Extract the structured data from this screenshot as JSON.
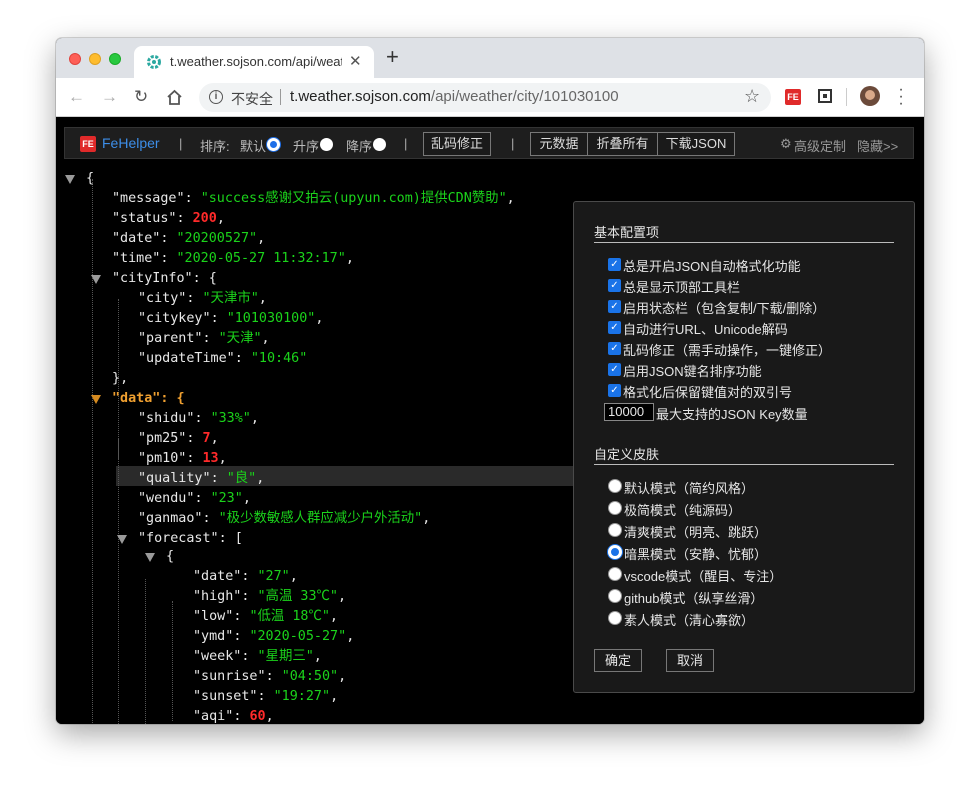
{
  "browser": {
    "tab_title": "t.weather.sojson.com/api/weat",
    "insecure_label": "不安全",
    "url_host": "t.weather.sojson.com",
    "url_path": "/api/weather/city/101030100"
  },
  "fehelper": {
    "brand": "FeHelper",
    "sort_label": "排序:",
    "sort_default": "默认",
    "sort_asc": "升序",
    "sort_desc": "降序",
    "fix_button": "乱码修正",
    "raw_button": "元数据",
    "collapse_button": "折叠所有",
    "download_button": "下载JSON",
    "advanced": "高级定制",
    "hide": "隐藏>>"
  },
  "json_view": {
    "lines": [
      {
        "indent": 0,
        "key": "",
        "sep": "",
        "value": "{",
        "vtype": "p",
        "comma": ""
      },
      {
        "indent": 1,
        "key": "\"message\"",
        "sep": ": ",
        "value": "\"success感谢又拍云(upyun.com)提供CDN赞助\"",
        "vtype": "s",
        "comma": ","
      },
      {
        "indent": 1,
        "key": "\"status\"",
        "sep": ": ",
        "value": "200",
        "vtype": "n",
        "comma": ","
      },
      {
        "indent": 1,
        "key": "\"date\"",
        "sep": ": ",
        "value": "\"20200527\"",
        "vtype": "s",
        "comma": ","
      },
      {
        "indent": 1,
        "key": "\"time\"",
        "sep": ": ",
        "value": "\"2020-05-27 11:32:17\"",
        "vtype": "s",
        "comma": ","
      },
      {
        "indent": 1,
        "key": "\"cityInfo\"",
        "sep": ": ",
        "value": "{",
        "vtype": "p",
        "comma": ""
      },
      {
        "indent": 2,
        "key": "\"city\"",
        "sep": ": ",
        "value": "\"天津市\"",
        "vtype": "s",
        "comma": ","
      },
      {
        "indent": 2,
        "key": "\"citykey\"",
        "sep": ": ",
        "value": "\"101030100\"",
        "vtype": "s",
        "comma": ","
      },
      {
        "indent": 2,
        "key": "\"parent\"",
        "sep": ": ",
        "value": "\"天津\"",
        "vtype": "s",
        "comma": ","
      },
      {
        "indent": 2,
        "key": "\"updateTime\"",
        "sep": ": ",
        "value": "\"10:46\"",
        "vtype": "s",
        "comma": ""
      },
      {
        "indent": 1,
        "key": "",
        "sep": "",
        "value": "}",
        "vtype": "p",
        "comma": ","
      },
      {
        "indent": 1,
        "key": "\"data\"",
        "sep": ": ",
        "value": "{",
        "vtype": "p",
        "comma": ""
      },
      {
        "indent": 2,
        "key": "\"shidu\"",
        "sep": ": ",
        "value": "\"33%\"",
        "vtype": "s",
        "comma": ","
      },
      {
        "indent": 2,
        "key": "\"pm25\"",
        "sep": ": ",
        "value": "7",
        "vtype": "n",
        "comma": ","
      },
      {
        "indent": 2,
        "key": "\"pm10\"",
        "sep": ": ",
        "value": "13",
        "vtype": "n",
        "comma": ","
      },
      {
        "indent": 2,
        "key": "\"quality\"",
        "sep": ": ",
        "value": "\"良\"",
        "vtype": "s",
        "comma": ","
      },
      {
        "indent": 2,
        "key": "\"wendu\"",
        "sep": ": ",
        "value": "\"23\"",
        "vtype": "s",
        "comma": ","
      },
      {
        "indent": 2,
        "key": "\"ganmao\"",
        "sep": ": ",
        "value": "\"极少数敏感人群应减少户外活动\"",
        "vtype": "s",
        "comma": ","
      },
      {
        "indent": 2,
        "key": "\"forecast\"",
        "sep": ": ",
        "value": "[",
        "vtype": "p",
        "comma": ""
      },
      {
        "indent": 3,
        "key": "",
        "sep": "",
        "value": "{",
        "vtype": "p",
        "comma": ""
      },
      {
        "indent": 4,
        "key": "\"date\"",
        "sep": ": ",
        "value": "\"27\"",
        "vtype": "s",
        "comma": ","
      },
      {
        "indent": 4,
        "key": "\"high\"",
        "sep": ": ",
        "value": "\"高温 33℃\"",
        "vtype": "s",
        "comma": ","
      },
      {
        "indent": 4,
        "key": "\"low\"",
        "sep": ": ",
        "value": "\"低温 18℃\"",
        "vtype": "s",
        "comma": ","
      },
      {
        "indent": 4,
        "key": "\"ymd\"",
        "sep": ": ",
        "value": "\"2020-05-27\"",
        "vtype": "s",
        "comma": ","
      },
      {
        "indent": 4,
        "key": "\"week\"",
        "sep": ": ",
        "value": "\"星期三\"",
        "vtype": "s",
        "comma": ","
      },
      {
        "indent": 4,
        "key": "\"sunrise\"",
        "sep": ": ",
        "value": "\"04:50\"",
        "vtype": "s",
        "comma": ","
      },
      {
        "indent": 4,
        "key": "\"sunset\"",
        "sep": ": ",
        "value": "\"19:27\"",
        "vtype": "s",
        "comma": ","
      },
      {
        "indent": 4,
        "key": "\"aqi\"",
        "sep": ": ",
        "value": "60",
        "vtype": "n",
        "comma": ","
      }
    ]
  },
  "settings": {
    "basic_title": "基本配置项",
    "basic_options": [
      {
        "label": "总是开启JSON自动格式化功能",
        "checked": true
      },
      {
        "label": "总是显示顶部工具栏",
        "checked": true
      },
      {
        "label": "启用状态栏（包含复制/下载/删除）",
        "checked": true
      },
      {
        "label": "自动进行URL、Unicode解码",
        "checked": true
      },
      {
        "label": "乱码修正（需手动操作，一键修正）",
        "checked": true
      },
      {
        "label": "启用JSON键名排序功能",
        "checked": true
      },
      {
        "label": "格式化后保留键值对的双引号",
        "checked": true
      }
    ],
    "max_keys_value": "10000",
    "max_keys_label": "最大支持的JSON Key数量",
    "skin_title": "自定义皮肤",
    "skins": [
      {
        "label": "默认模式（简约风格）",
        "selected": false
      },
      {
        "label": "极简模式（纯源码）",
        "selected": false
      },
      {
        "label": "清爽模式（明亮、跳跃）",
        "selected": false
      },
      {
        "label": "暗黑模式（安静、忧郁）",
        "selected": true
      },
      {
        "label": "vscode模式（醒目、专注）",
        "selected": false
      },
      {
        "label": "github模式（纵享丝滑）",
        "selected": false
      },
      {
        "label": "素人模式（清心寡欲）",
        "selected": false
      }
    ],
    "ok_button": "确定",
    "cancel_button": "取消"
  }
}
